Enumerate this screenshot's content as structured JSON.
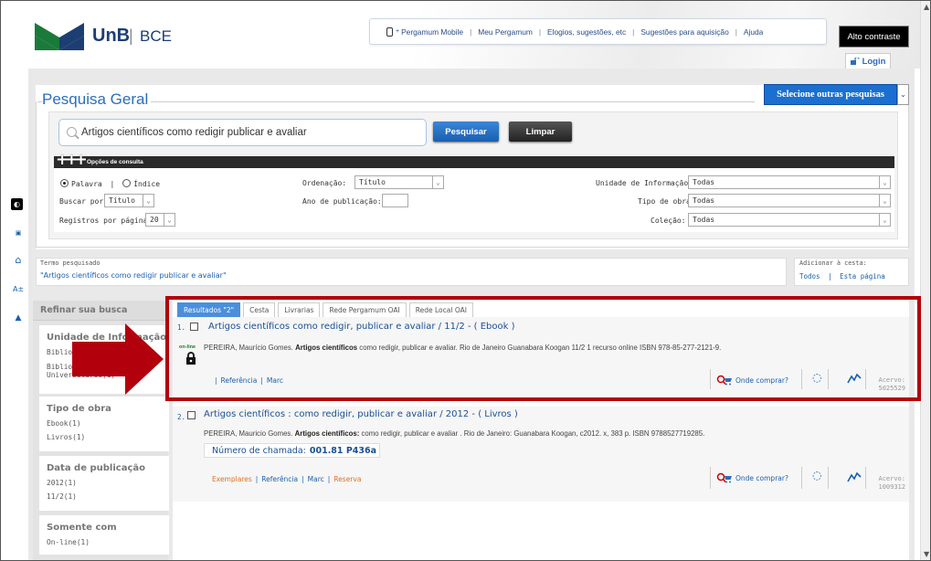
{
  "header": {
    "logo_unb": "UnB",
    "logo_sep": "|",
    "logo_bce": "BCE",
    "nav": [
      "Pergamum Mobile",
      "Meu Pergamum",
      "Elogios, sugestões, etc",
      "Sugestões para aquisição",
      "Ajuda"
    ],
    "alto_contraste": "Alto contraste",
    "login": "Login"
  },
  "search": {
    "page_title": "Pesquisa Geral",
    "outras_pesquisas": "Selecione outras pesquisas",
    "query": "Artigos científicos como redigir publicar e avaliar",
    "btn_pesquisar": "Pesquisar",
    "btn_limpar": "Limpar",
    "opcoes_title": "Opções de consulta",
    "radio_palavra": "Palavra",
    "radio_sep": "|",
    "radio_indice": "Índice",
    "buscar_por_label": "Buscar por:",
    "buscar_por_value": "Título",
    "registros_label": "Registros por página:",
    "registros_value": "20",
    "ordenacao_label": "Ordenação:",
    "ordenacao_value": "Título",
    "ano_label": "Ano de publicação:",
    "ano_value": "",
    "unidade_label": "Unidade de Informação:",
    "unidade_value": "Todas",
    "tipo_obra_label": "Tipo de obra:",
    "tipo_obra_value": "Todas",
    "colecao_label": "Coleção:",
    "colecao_value": "Todas"
  },
  "termo": {
    "label": "Termo pesquisado",
    "value": "\"Artigos científicos como redigir publicar e avaliar\""
  },
  "cesta": {
    "label": "Adicionar à cesta:",
    "todos": "Todos",
    "sep": "|",
    "esta_pagina": "Esta página"
  },
  "refine": {
    "title": "Refinar sua busca",
    "facets": [
      {
        "title": "Unidade de Informação",
        "items": [
          "Bibliote",
          "Bibliote",
          "Universitário(1)"
        ]
      },
      {
        "title": "Tipo de obra",
        "items": [
          "Ebook(1)",
          "Livros(1)"
        ]
      },
      {
        "title": "Data de publicação",
        "items": [
          "2012(1)",
          "11/2(1)"
        ]
      },
      {
        "title": "Somente com",
        "items": [
          "On-line(1)"
        ]
      }
    ]
  },
  "tabs": [
    "Resultados \"2\"",
    "Cesta",
    "Livrarias",
    "Rede Pergamum OAI",
    "Rede Local OAI"
  ],
  "records": [
    {
      "num": "1.",
      "title": "Artigos científicos como redigir, publicar e avaliar / 11/2 - ( Ebook )",
      "desc_pre": "PEREIRA, Maurício Gomes.",
      "desc_bold": "Artigos científicos",
      "desc_post": "como redigir, publicar e avaliar. Rio de Janeiro Guanabara Koogan 11/2 1 recurso online ISBN 978-85-277-2121-9.",
      "online": "on-line",
      "link_referencia": "Referência",
      "link_marc": "Marc",
      "sep": "|",
      "onde_comprar": "Onde comprar?",
      "acervo_label": "Acervo:",
      "acervo_num": "5025529"
    },
    {
      "num": "2.",
      "title": "Artigos científicos : como redigir, publicar e avaliar / 2012 - ( Livros )",
      "desc_pre": "PEREIRA, Mauricio Gomes.",
      "desc_bold": "Artigos científicos:",
      "desc_post": "como redigir, publicar e avaliar . Rio de Janeiro: Guanabara Koogan, c2012. x, 383 p. ISBN 9788527719285.",
      "chamada_label": "Número de chamada:",
      "chamada_value": "001.81 P436a",
      "link_exemplares": "Exemplares",
      "link_referencia": "Referência",
      "link_marc": "Marc",
      "link_reserva": "Reserva",
      "sep": "|",
      "onde_comprar": "Onde comprar?",
      "acervo_label": "Acervo:",
      "acervo_num": "1009312"
    }
  ],
  "colors": {
    "highlight_border": "#b3000d",
    "link_blue": "#1a5fb0",
    "orange_link": "#e07020",
    "button_blue": "#1a6fd0"
  }
}
